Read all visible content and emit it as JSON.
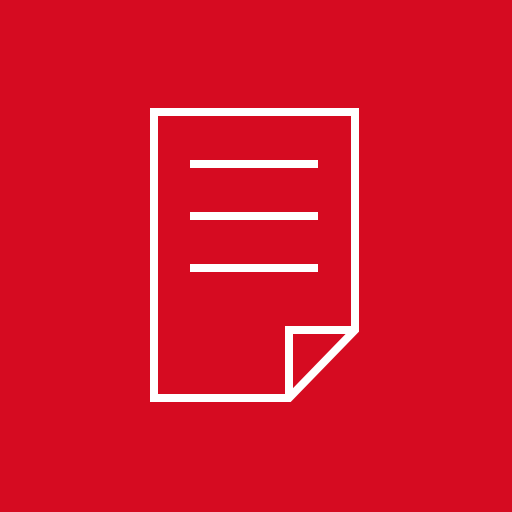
{
  "tile": {
    "icon": "document-icon",
    "background_color": "#d60b21",
    "icon_color": "#ffffff"
  }
}
